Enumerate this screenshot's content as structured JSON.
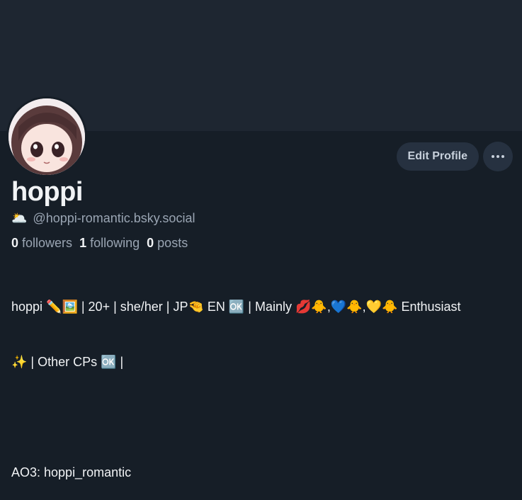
{
  "profile": {
    "display_name": "hoppi",
    "handle_emoji": "🌥️",
    "handle": "@hoppi-romantic.bsky.social",
    "followers_count": "0",
    "followers_label": "followers",
    "following_count": "1",
    "following_label": "following",
    "posts_count": "0",
    "posts_label": "posts",
    "bio_line1": "hoppi ✏️🖼️ | 20+ | she/her | JP🤏 EN 🆗 | Mainly 💋🐥,💙🐥,💛🐥 Enthusiast",
    "bio_line2": "✨ | Other CPs 🆗 |",
    "bio_line3": "",
    "bio_line4": "AO3: hoppi_romantic"
  },
  "actions": {
    "edit_label": "Edit Profile",
    "more_icon": "ellipsis-icon"
  },
  "colors": {
    "background": "#161e27",
    "banner": "#1e2631",
    "button_bg": "#263140",
    "muted_text": "#9aa5b3"
  }
}
